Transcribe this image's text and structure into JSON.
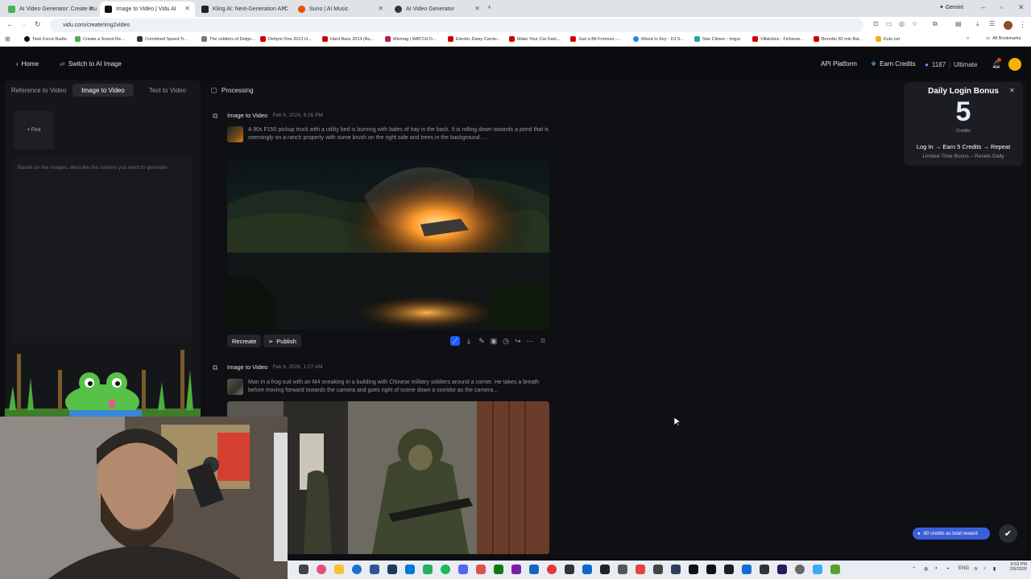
{
  "browser": {
    "tabs": [
      {
        "label": "AI Video Generator: Create stu",
        "color": "#4caf50"
      },
      {
        "label": "Image to Video | Vidu AI",
        "color": "#111111",
        "active": true
      },
      {
        "label": "Kling AI: Next-Generation AI C",
        "color": "#222222"
      },
      {
        "label": "Suno | AI Music",
        "color": "#e65100"
      },
      {
        "label": "AI Video Generator",
        "color": "#333333"
      }
    ],
    "new_tab": "+",
    "gemini_label": "Gemini",
    "url": "vidu.com/create/img2video",
    "bookmarks": [
      "Task Force Radio",
      "Create a Sound Re...",
      "Combined Speed Tr...",
      "The soldiers of Defgo...",
      "Defqon One 2013 H...",
      "Hard Bass 2013 (Au...",
      "Mixmag | WATCH D...",
      "Electric Daisy Carniv...",
      "Make Your Car Fast...",
      "Just a Bit Fortress -...",
      "Mixed In Key - DJ S...",
      "Star Citizen - Imgur",
      "Villalobos - Fizheuer...",
      "Bonobo 50 min Bal...",
      "Kutz.net"
    ],
    "all_bookmarks": "All Bookmarks"
  },
  "header": {
    "home": "Home",
    "switch": "Switch to AI Image",
    "api": "API Platform",
    "earn": "Earn Credits",
    "credits": "1187",
    "plan": "Ultimate"
  },
  "left": {
    "tabs": [
      "Reference to Video",
      "Image to Video",
      "Text to Video"
    ],
    "first_label": "+ First",
    "prompt_placeholder": "Based on the images, describe the content you want to generate"
  },
  "main": {
    "processing": "Processing",
    "entries": [
      {
        "type": "Image to Video",
        "date": "Feb 6, 2026, 6:26 PM",
        "desc": "A 90s F150 pickup truck with a utility bed is burning with bales of hay in the back. It is rolling down towards a pond that is seemingly on a ranch property with some brush on the right side and trees in the background. ..."
      },
      {
        "type": "Image to Video",
        "date": "Feb 6, 2026, 1:07 AM",
        "desc": "Man in a frog suit with an M4 sneaking in a building with Chinese military soldiers around a corner. He takes a breath before moving forward towards the camera and goes right of scene down a corridor as the camera..."
      }
    ],
    "recreate": "Recreate",
    "publish": "Publish"
  },
  "bonus": {
    "title": "Daily Login Bonus",
    "number": "5",
    "unit": "Credits",
    "line": "Log In → Earn 5 Credits → Repeat",
    "sub": "Limited-Time Bonus – Resets Daily"
  },
  "reward": "60 credits as total reward",
  "taskbar": {
    "lang": "ENG",
    "time": "9:53 PM",
    "date": "2/9/2026"
  },
  "colors": {
    "accent": "#3b5fd9",
    "background": "#0d0e11"
  }
}
